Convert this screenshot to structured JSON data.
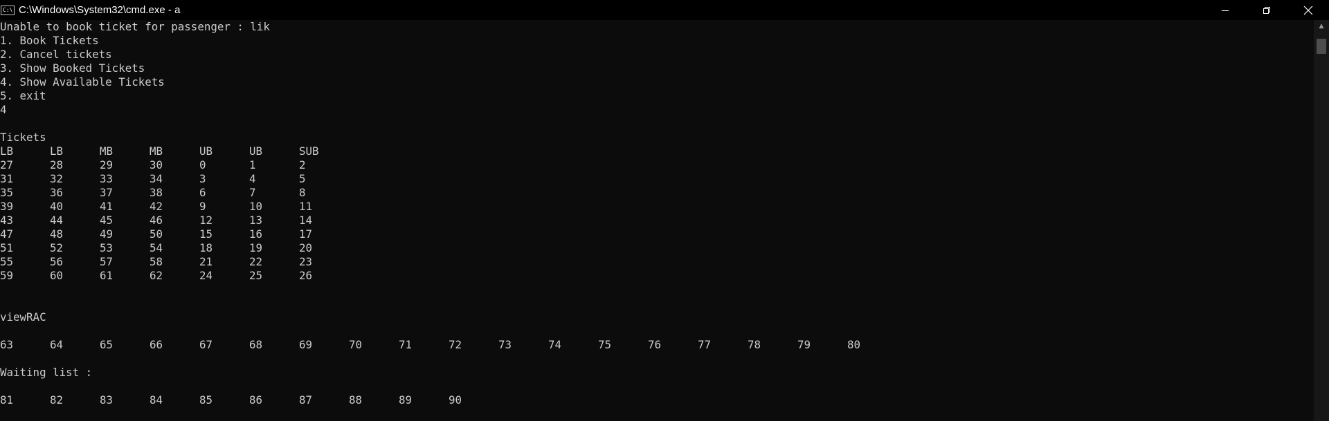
{
  "window": {
    "title": "C:\\Windows\\System32\\cmd.exe - a",
    "icon_text": "C:\\",
    "minimize_icon": "minimize-icon",
    "maximize_icon": "restore-icon",
    "close_icon": "close-icon"
  },
  "console": {
    "menu_lines": [
      "Unable to book ticket for passenger : lik",
      "1. Book Tickets",
      "2. Cancel tickets",
      "3. Show Booked Tickets",
      "4. Show Available Tickets",
      "5. exit",
      "4",
      "",
      "Tickets"
    ],
    "tickets_header": [
      "LB",
      "LB",
      "MB",
      "MB",
      "UB",
      "UB",
      "SUB"
    ],
    "tickets_rows": [
      [
        "27",
        "28",
        "29",
        "30",
        "0",
        "1",
        "2"
      ],
      [
        "31",
        "32",
        "33",
        "34",
        "3",
        "4",
        "5"
      ],
      [
        "35",
        "36",
        "37",
        "38",
        "6",
        "7",
        "8"
      ],
      [
        "39",
        "40",
        "41",
        "42",
        "9",
        "10",
        "11"
      ],
      [
        "43",
        "44",
        "45",
        "46",
        "12",
        "13",
        "14"
      ],
      [
        "47",
        "48",
        "49",
        "50",
        "15",
        "16",
        "17"
      ],
      [
        "51",
        "52",
        "53",
        "54",
        "18",
        "19",
        "20"
      ],
      [
        "55",
        "56",
        "57",
        "58",
        "21",
        "22",
        "23"
      ],
      [
        "59",
        "60",
        "61",
        "62",
        "24",
        "25",
        "26"
      ]
    ],
    "rac_label": "viewRAC",
    "rac_values": [
      "63",
      "64",
      "65",
      "66",
      "67",
      "68",
      "69",
      "70",
      "71",
      "72",
      "73",
      "74",
      "75",
      "76",
      "77",
      "78",
      "79",
      "80"
    ],
    "waiting_label": "Waiting list :",
    "waiting_values": [
      "81",
      "82",
      "83",
      "84",
      "85",
      "86",
      "87",
      "88",
      "89",
      "90"
    ]
  }
}
